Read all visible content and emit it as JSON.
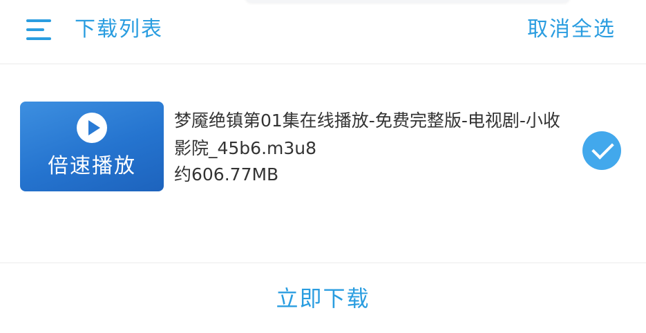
{
  "header": {
    "title": "下载列表",
    "deselect_all": "取消全选",
    "accent_color": "#2a9de0"
  },
  "item": {
    "thumbnail_label": "倍速播放",
    "thumbnail_icon": "play-icon",
    "file_name": "梦魇绝镇第01集在线播放-免费完整版-电视剧-小收影院_45b6.m3u8",
    "file_size": "约606.77MB",
    "selected": true,
    "check_color": "#42a8ec"
  },
  "footer": {
    "download_label": "立即下载"
  }
}
